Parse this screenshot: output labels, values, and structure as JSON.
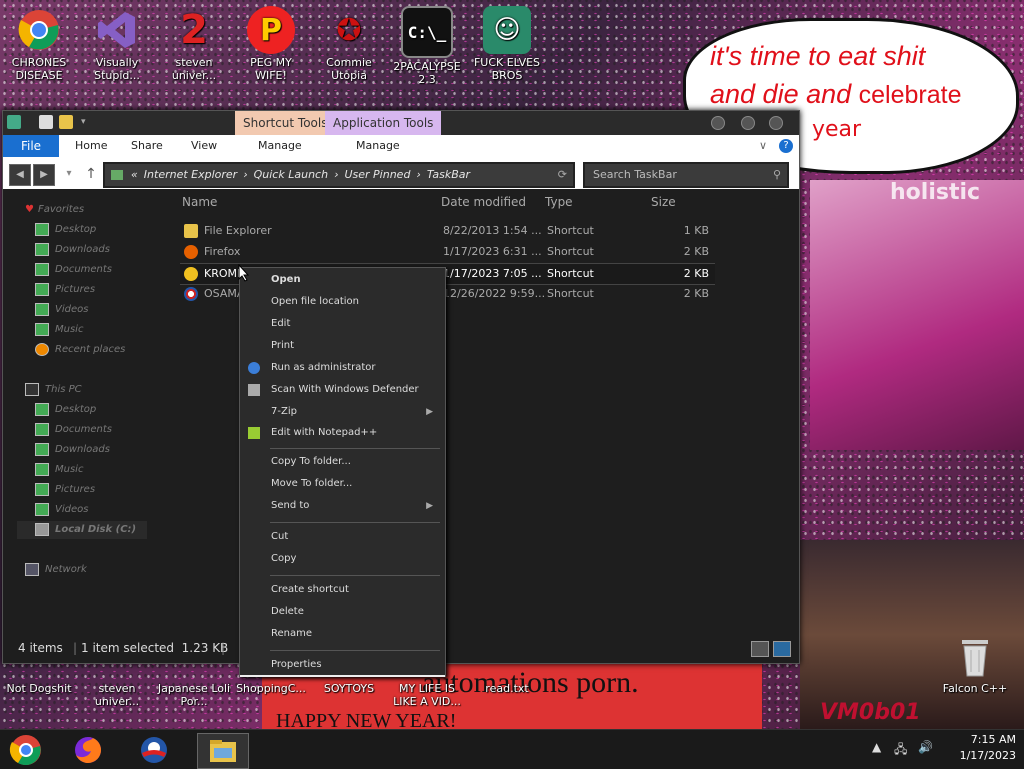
{
  "desktop": {
    "top_icons": [
      {
        "label": "CHRONES DISEASE"
      },
      {
        "label": "Visually Stupid..."
      },
      {
        "label": "steven univer..."
      },
      {
        "label": "PEG MY WIFE!"
      },
      {
        "label": "Commie Utopia"
      },
      {
        "label": "2PACALYPSE 2.3"
      },
      {
        "label": "FUCK ELVES BROS"
      }
    ],
    "bottom_icons": [
      {
        "label": "Not Dogshit"
      },
      {
        "label": "steven univer..."
      },
      {
        "label": "Japanese Loli Por..."
      },
      {
        "label": "ShoppingC..."
      },
      {
        "label": "SOYTOYS"
      },
      {
        "label": "MY LIFE IS LIKE A VID..."
      },
      {
        "label": "read.txt"
      },
      {
        "label": "Falcon C++"
      }
    ],
    "wallpaper_text": {
      "speech_line1": "it's time to eat shit",
      "speech_line2a": "and die and ",
      "speech_line2b": "celebrate",
      "speech_line3": "year",
      "holistic": "holistic",
      "bottom_line1": "automations porn.",
      "bottom_line2": "HAPPY NEW YEAR!",
      "signature": "VM0b01"
    }
  },
  "explorer": {
    "contextual_tabs": [
      "Shortcut Tools",
      "Application Tools"
    ],
    "ribbon_tabs": {
      "file": "File",
      "home": "Home",
      "share": "Share",
      "view": "View",
      "manage1": "Manage",
      "manage2": "Manage"
    },
    "address": {
      "prefix": "«",
      "segments": [
        "Internet Explorer",
        "Quick Launch",
        "User Pinned",
        "TaskBar"
      ],
      "search_placeholder": "Search TaskBar"
    },
    "nav": {
      "favorites": "Favorites",
      "fav_items": [
        "Desktop",
        "Downloads",
        "Documents",
        "Pictures",
        "Videos",
        "Music",
        "Recent places"
      ],
      "this_pc": "This PC",
      "pc_items": [
        "Desktop",
        "Documents",
        "Downloads",
        "Music",
        "Pictures",
        "Videos",
        "Local Disk (C:)"
      ],
      "network": "Network"
    },
    "columns": {
      "name": "Name",
      "date": "Date modified",
      "type": "Type",
      "size": "Size"
    },
    "files": [
      {
        "name": "File Explorer",
        "date": "8/22/2013 1:54 ...",
        "type": "Shortcut",
        "size": "1 KB"
      },
      {
        "name": "Firefox",
        "date": "1/17/2023 6:31 ...",
        "type": "Shortcut",
        "size": "2 KB"
      },
      {
        "name": "KROME",
        "date": "1/17/2023 7:05 ...",
        "type": "Shortcut",
        "size": "2 KB"
      },
      {
        "name": "OSAMA",
        "date": "12/26/2022 9:59...",
        "type": "Shortcut",
        "size": "2 KB"
      }
    ],
    "status": {
      "items": "4 items",
      "selected": "1 item selected  1.23 KB"
    }
  },
  "context_menu": {
    "open": "Open",
    "open_location": "Open file location",
    "edit": "Edit",
    "print": "Print",
    "run_admin": "Run as administrator",
    "scan": "Scan With Windows Defender",
    "zip": "7-Zip",
    "notepad": "Edit with Notepad++",
    "copy_to": "Copy To folder...",
    "move_to": "Move To folder...",
    "send_to": "Send to",
    "cut": "Cut",
    "copy": "Copy",
    "create_shortcut": "Create shortcut",
    "delete": "Delete",
    "rename": "Rename",
    "properties": "Properties"
  },
  "taskbar": {
    "time": "7:15 AM",
    "date": "1/17/2023"
  },
  "colors": {
    "file_tab": "#1a6fd0",
    "shortcut_tools_tab": "#f2c9b0",
    "application_tools_tab": "#d7b7ef",
    "window_bg": "#1e1e1e"
  }
}
